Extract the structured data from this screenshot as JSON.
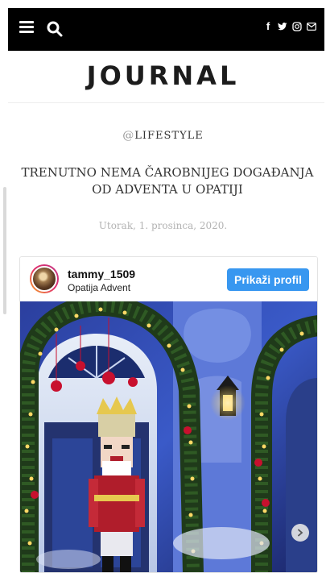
{
  "header": {
    "menu_icon": "hamburger-menu-icon",
    "search_icon": "search-icon",
    "social_icons": [
      "facebook-icon",
      "twitter-icon",
      "instagram-icon",
      "mail-icon"
    ],
    "background": "#000000"
  },
  "site": {
    "logo": "JOURNAL"
  },
  "article": {
    "category_prefix": "@",
    "category": "LIFESTYLE",
    "title": "TRENUTNO NEMA ČAROBNIJEG DOGAĐANJA OD ADVENTA U OPATIJI",
    "date": "Utorak, 1. prosinca, 2020."
  },
  "instagram_embed": {
    "username": "tammy_1509",
    "location": "Opatija Advent",
    "profile_button": "Prikaži profil",
    "button_color": "#3897f0",
    "photo_subject": "Nutcracker figure in front of decorated doorway with garlands and lights",
    "next_icon": "chevron-right-icon"
  }
}
